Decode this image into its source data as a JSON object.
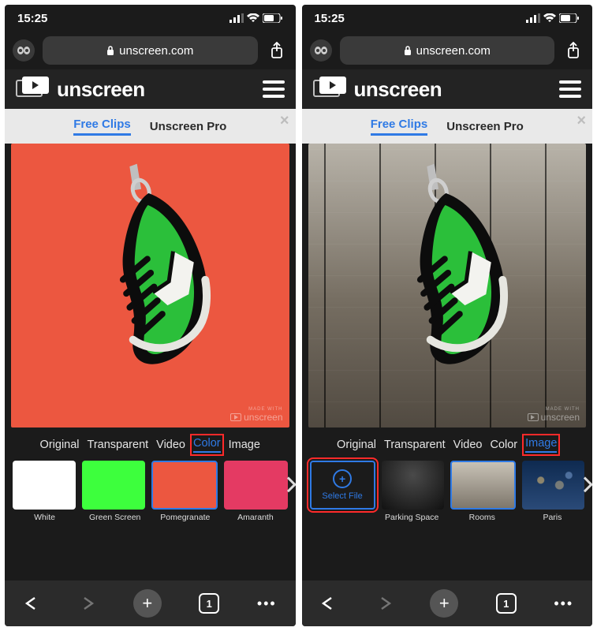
{
  "status": {
    "time": "15:25"
  },
  "url": {
    "domain": "unscreen.com"
  },
  "brand": {
    "name": "unscreen"
  },
  "header_tabs": {
    "free": "Free Clips",
    "pro": "Unscreen Pro"
  },
  "watermark": {
    "prefix": "MADE WITH",
    "brand": "unscreen"
  },
  "bg_tabs": {
    "original": "Original",
    "transparent": "Transparent",
    "video": "Video",
    "color": "Color",
    "image": "Image"
  },
  "left": {
    "swatches": [
      {
        "label": "White",
        "color": "#ffffff"
      },
      {
        "label": "Green Screen",
        "color": "#3dff3d"
      },
      {
        "label": "Pomegranate",
        "color": "#ec5740",
        "selected": true
      },
      {
        "label": "Amaranth",
        "color": "#e43a63"
      }
    ]
  },
  "right": {
    "select_file": "Select File",
    "thumbs": [
      {
        "label": "Parking Space",
        "kind": "parking"
      },
      {
        "label": "Rooms",
        "kind": "rooms",
        "selected": true
      },
      {
        "label": "Paris",
        "kind": "paris"
      }
    ]
  },
  "bbar": {
    "tab_count": "1"
  }
}
